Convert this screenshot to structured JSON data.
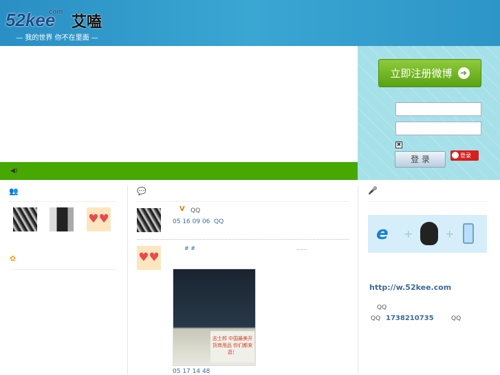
{
  "header": {
    "logo_main": "52kee",
    "logo_com": ".com",
    "logo_cn": "艾嗑",
    "slogan": "— 我的世界  你不在里面 —"
  },
  "login": {
    "register_label": "立即注册微博",
    "login_label": "登 录",
    "weibo_login_label": "登录",
    "remember_mark": "✖"
  },
  "left": {
    "friends_icon": "👥",
    "flower_icon": "✿"
  },
  "feed": {
    "header_icon": "💬",
    "post1": {
      "v_badge": "V",
      "source": "QQ",
      "time": "05 16  09 06",
      "via": "QQ"
    },
    "post2": {
      "tags": "#   #",
      "more": "......",
      "sign_text": "志士邦 中国最美开货商用品 你们都来逛！",
      "time": "05 17  14 48"
    }
  },
  "right": {
    "mic_icon": "🎤",
    "url": "http://w.52kee.com",
    "qq1": "QQ",
    "qq_label": "QQ",
    "qq_number": "1738210735",
    "qq3": "QQ"
  },
  "green_bar": {
    "speaker_icon": "◀)"
  }
}
